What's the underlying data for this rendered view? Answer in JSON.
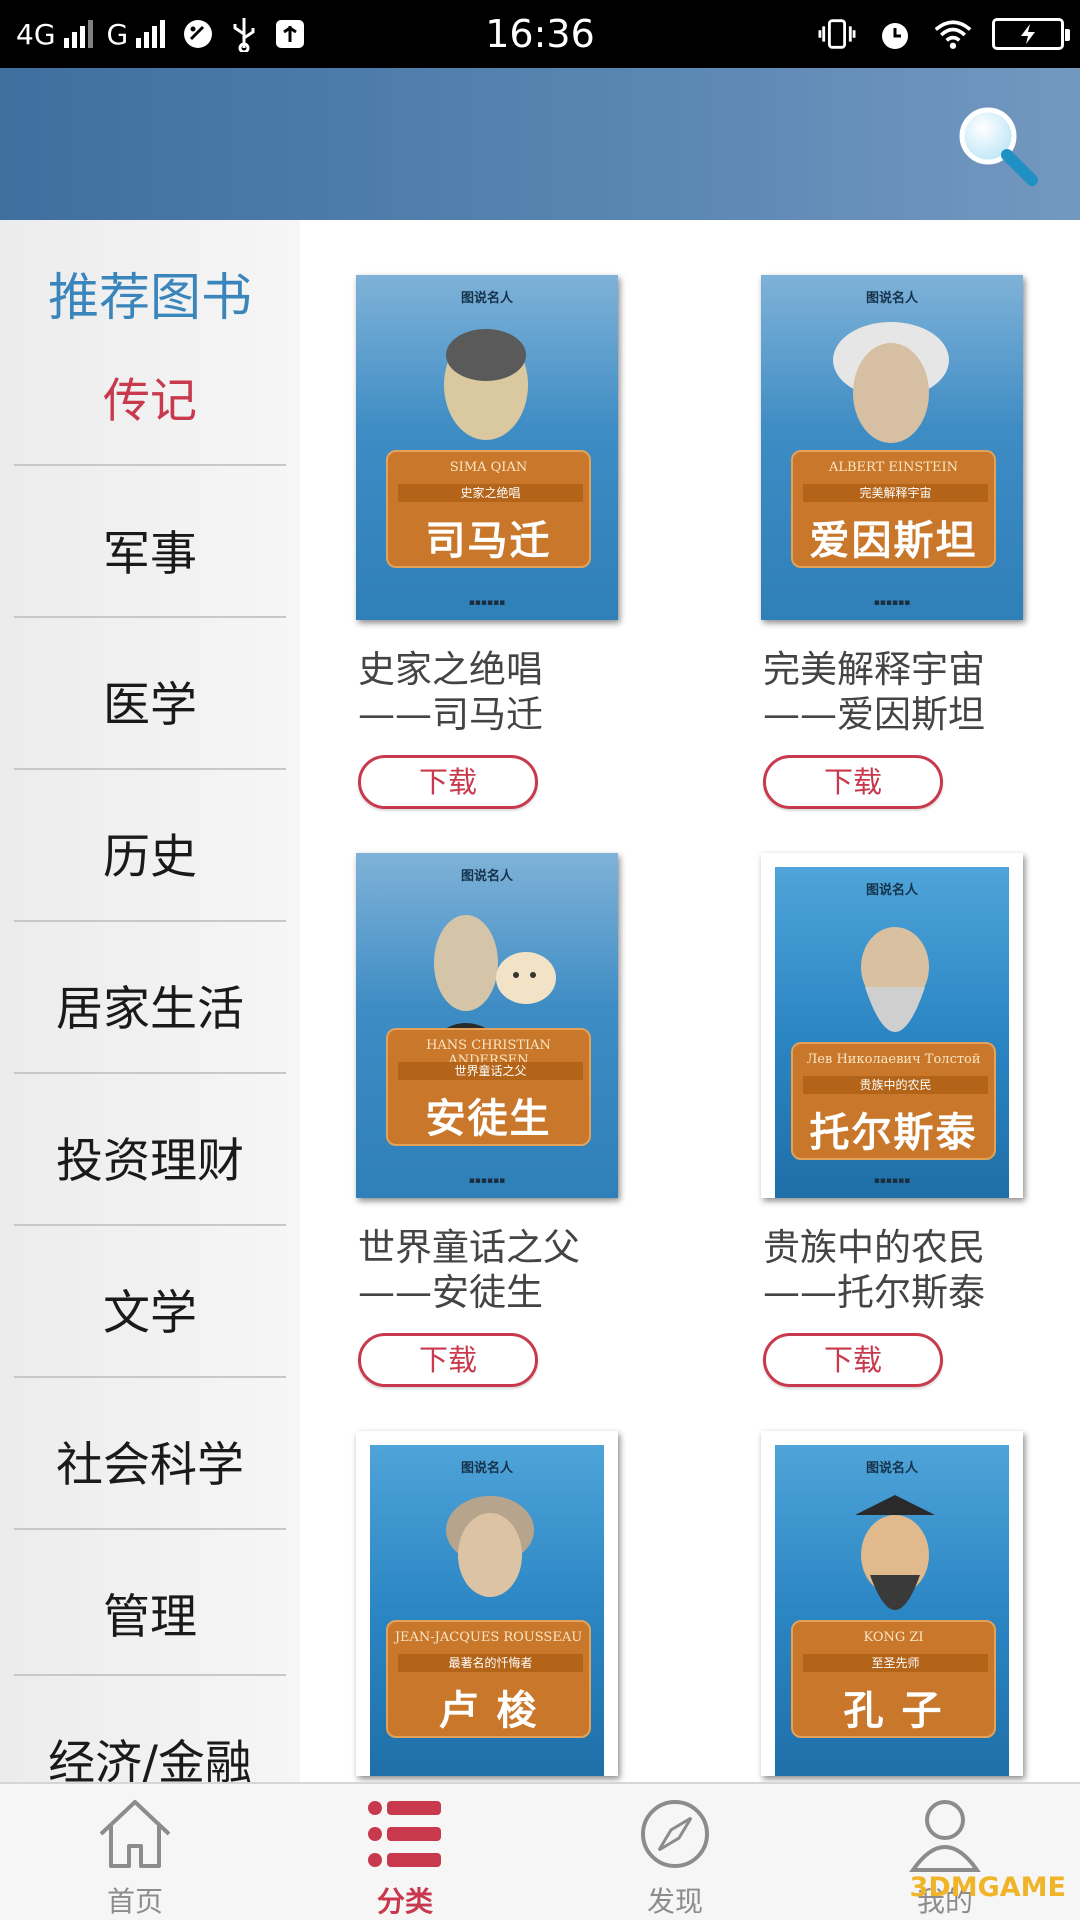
{
  "status_bar": {
    "network1": "4G",
    "network2": "G",
    "time": "16:36"
  },
  "sidebar": {
    "recommended": "推荐图书",
    "selected": "传记",
    "items": [
      "军事",
      "医学",
      "历史",
      "居家生活",
      "投资理财",
      "文学",
      "社会科学",
      "管理",
      "经济/金融"
    ]
  },
  "books": [
    {
      "series": "图说名人",
      "en": "SIMA QIAN",
      "subtitle": "史家之绝唱",
      "name": "司马迁",
      "title": "史家之绝唱\n——司马迁",
      "download": "下载"
    },
    {
      "series": "图说名人",
      "en": "ALBERT EINSTEIN",
      "subtitle": "完美解释宇宙",
      "name": "爱因斯坦",
      "title": "完美解释宇宙\n——爱因斯坦",
      "download": "下载"
    },
    {
      "series": "图说名人",
      "en": "HANS CHRISTIAN ANDERSEN",
      "subtitle": "世界童话之父",
      "name": "安徒生",
      "title": "世界童话之父\n——安徒生",
      "download": "下载"
    },
    {
      "series": "图说名人",
      "en": "Лев Николаевич Толстой",
      "subtitle": "贵族中的农民",
      "name": "托尔斯泰",
      "title": "贵族中的农民\n——托尔斯泰",
      "download": "下载"
    },
    {
      "series": "图说名人",
      "en": "JEAN-JACQUES ROUSSEAU",
      "subtitle": "最著名的忏悔者",
      "name": "卢 梭"
    },
    {
      "series": "图说名人",
      "en": "KONG ZI",
      "subtitle": "至圣先师",
      "name": "孔 子"
    }
  ],
  "nav": {
    "home": "首页",
    "category": "分类",
    "discover": "发现",
    "mine": "我的"
  },
  "watermark": "3DMGAME",
  "colors": {
    "accent": "#c8394d",
    "sidebar_highlight": "#3a86bc",
    "header": "#5a86b3"
  }
}
